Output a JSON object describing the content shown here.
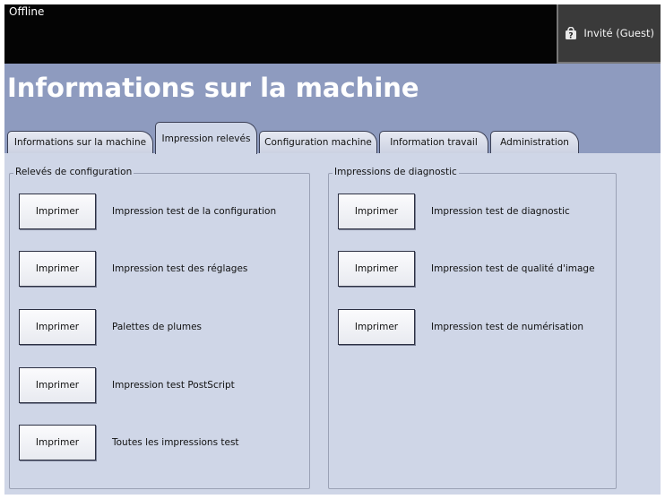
{
  "status": "Offline",
  "user": {
    "label": "Invité (Guest)",
    "icon": "question-lock-icon"
  },
  "title": "Informations sur la machine",
  "tabs": [
    {
      "label": "Informations sur la machine",
      "active": false
    },
    {
      "label": "Impression relevés",
      "active": true
    },
    {
      "label": "Configuration machine",
      "active": false
    },
    {
      "label": "Information travail",
      "active": false
    },
    {
      "label": "Administration",
      "active": false
    }
  ],
  "groups": {
    "config": {
      "legend": "Relevés de configuration",
      "items": [
        {
          "button": "Imprimer",
          "label": "Impression test de la configuration"
        },
        {
          "button": "Imprimer",
          "label": "Impression test des réglages"
        },
        {
          "button": "Imprimer",
          "label": "Palettes de plumes"
        },
        {
          "button": "Imprimer",
          "label": "Impression test PostScript"
        },
        {
          "button": "Imprimer",
          "label": "Toutes les impressions test"
        }
      ]
    },
    "diag": {
      "legend": "Impressions de diagnostic",
      "items": [
        {
          "button": "Imprimer",
          "label": "Impression test de diagnostic"
        },
        {
          "button": "Imprimer",
          "label": "Impression test de qualité d'image"
        },
        {
          "button": "Imprimer",
          "label": "Impression test de numérisation"
        }
      ]
    }
  },
  "colors": {
    "topbar": "#040404",
    "header": "#8e9bbf",
    "panel": "#cfd6e7"
  }
}
